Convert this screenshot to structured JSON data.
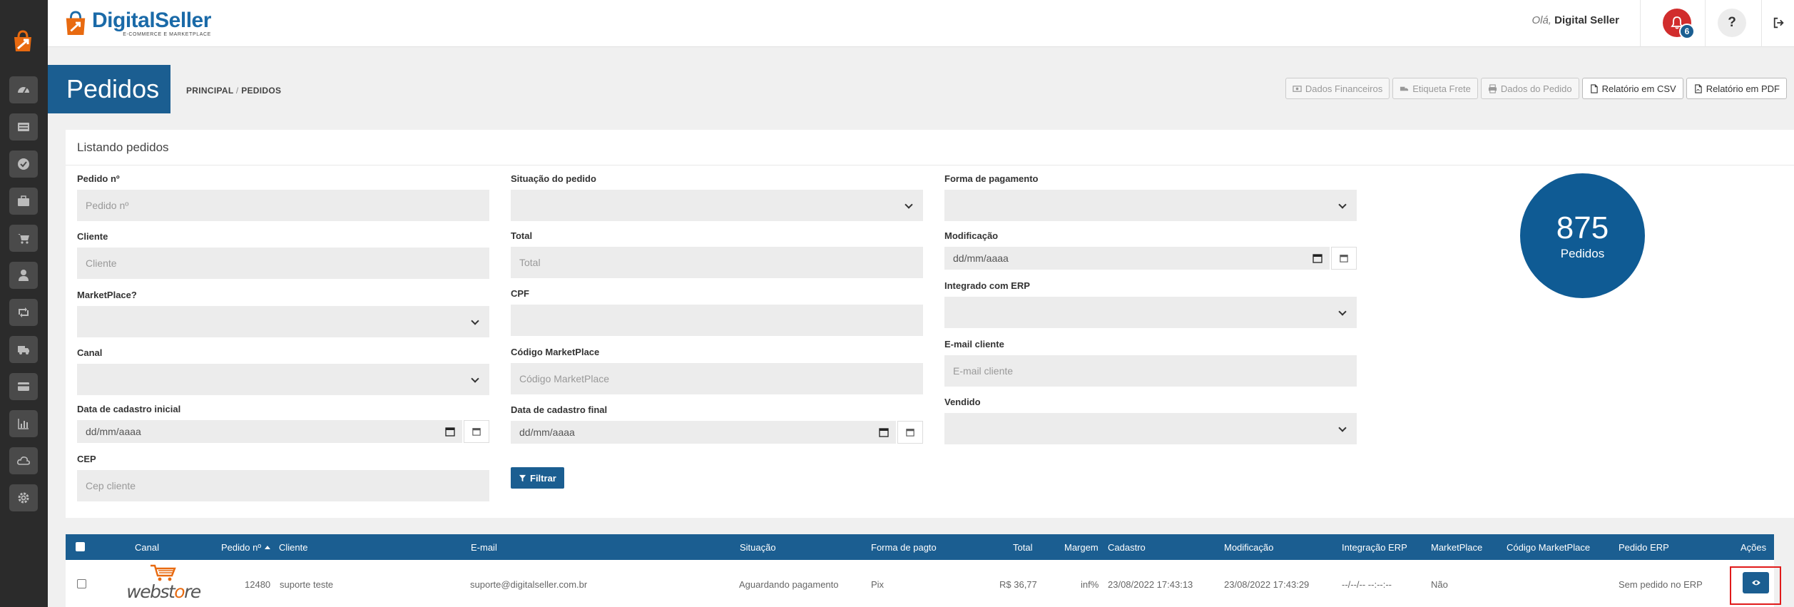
{
  "brand": {
    "name_part1": "Digital",
    "name_part2": "Seller",
    "tagline": "E-COMMERCE E MARKETPLACE",
    "colors": {
      "primary": "#1b5e91",
      "accent": "#e86a10",
      "alert": "#d12d2d"
    }
  },
  "sidebar": {
    "items": [
      {
        "icon": "dashboard-icon"
      },
      {
        "icon": "list-icon"
      },
      {
        "icon": "check-circle-icon"
      },
      {
        "icon": "briefcase-icon"
      },
      {
        "icon": "cart-icon"
      },
      {
        "icon": "user-icon"
      },
      {
        "icon": "retweet-icon"
      },
      {
        "icon": "truck-icon"
      },
      {
        "icon": "credit-card-icon"
      },
      {
        "icon": "bar-chart-icon"
      },
      {
        "icon": "cloud-icon"
      },
      {
        "icon": "gear-icon"
      }
    ]
  },
  "header": {
    "greeting_prefix": "Olá,",
    "user_name": "Digital Seller",
    "notification_count": "6",
    "help_label": "?"
  },
  "page": {
    "title": "Pedidos",
    "breadcrumb_home": "PRINCIPAL",
    "breadcrumb_sep": "/",
    "breadcrumb_current": "PEDIDOS"
  },
  "toolbar": {
    "financial": "Dados Financeiros",
    "shipping_label": "Etiqueta Frete",
    "order_data": "Dados do Pedido",
    "csv_report": "Relatório em CSV",
    "pdf_report": "Relatório em PDF"
  },
  "panel": {
    "title": "Listando pedidos"
  },
  "filters": {
    "order_no": {
      "label": "Pedido nº",
      "placeholder": "Pedido nº"
    },
    "client": {
      "label": "Cliente",
      "placeholder": "Cliente"
    },
    "marketplace": {
      "label": "MarketPlace?"
    },
    "channel": {
      "label": "Canal"
    },
    "register_start": {
      "label": "Data de cadastro inicial",
      "value": "dd/mm/aaaa"
    },
    "cep": {
      "label": "CEP",
      "placeholder": "Cep cliente"
    },
    "status": {
      "label": "Situação do pedido"
    },
    "total": {
      "label": "Total",
      "placeholder": "Total"
    },
    "cpf": {
      "label": "CPF",
      "placeholder": ""
    },
    "marketplace_code": {
      "label": "Código MarketPlace",
      "placeholder": "Código MarketPlace"
    },
    "register_end": {
      "label": "Data de cadastro final",
      "value": "dd/mm/aaaa"
    },
    "payment": {
      "label": "Forma de pagamento"
    },
    "modified": {
      "label": "Modificação",
      "value": "dd/mm/aaaa"
    },
    "erp_integrated": {
      "label": "Integrado com ERP"
    },
    "client_email": {
      "label": "E-mail cliente",
      "placeholder": "E-mail cliente"
    },
    "sold": {
      "label": "Vendido"
    },
    "filter_button": "Filtrar"
  },
  "summary": {
    "count": "875",
    "label": "Pedidos"
  },
  "table": {
    "columns": {
      "channel": "Canal",
      "order_no": "Pedido nº",
      "client": "Cliente",
      "email": "E-mail",
      "status": "Situação",
      "payment": "Forma de pagto",
      "total": "Total",
      "margin": "Margem",
      "registered": "Cadastro",
      "modified": "Modificação",
      "erp_integration": "Integração ERP",
      "marketplace": "MarketPlace",
      "marketplace_code": "Código MarketPlace",
      "erp_order": "Pedido ERP",
      "actions": "Ações"
    },
    "rows": [
      {
        "channel_logo_a": "web",
        "channel_logo_b": "st",
        "channel_logo_c": "o",
        "channel_logo_d": "re",
        "order_no": "12480",
        "client": "suporte teste",
        "email": "suporte@digitalseller.com.br",
        "status": "Aguardando pagamento",
        "payment": "Pix",
        "total": "R$ 36,77",
        "margin": "inf%",
        "registered": "23/08/2022 17:43:13",
        "modified": "23/08/2022 17:43:29",
        "erp_integration": "--/--/-- --:--:--",
        "marketplace": "Não",
        "marketplace_code": "",
        "erp_order": "Sem pedido no ERP"
      }
    ]
  }
}
